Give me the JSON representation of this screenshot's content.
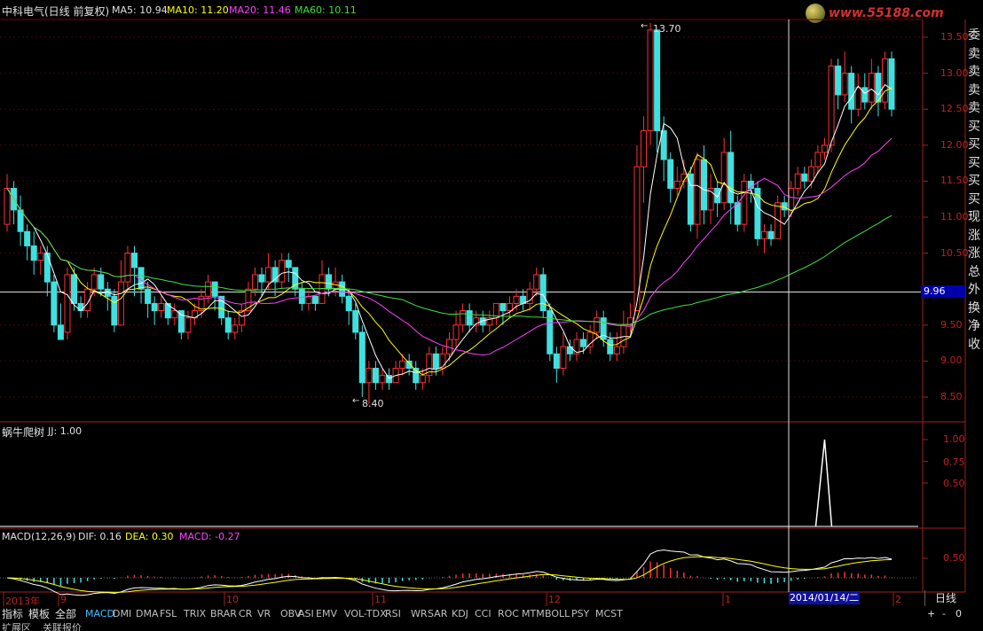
{
  "header": {
    "title": "中科电气(日线 前复权)",
    "ma5": "MA5: 10.94",
    "ma10": "MA10: 11.20",
    "ma20": "MA20: 11.46",
    "ma60": "MA60: 10.11"
  },
  "colors": {
    "ma5": "#ffffff",
    "ma10": "#ffff00",
    "ma20": "#ff40ff",
    "ma60": "#40e040",
    "up": "#ff3030",
    "down": "#40e0e0",
    "axis": "#c02020"
  },
  "logo": "www.55188.com",
  "price_axis": [
    "13.50",
    "13.00",
    "12.50",
    "12.00",
    "11.50",
    "11.00",
    "10.50",
    "9.96",
    "9.50",
    "9.00",
    "8.50"
  ],
  "current_price": "9.96",
  "high_label": "13.70",
  "low_label": "8.40",
  "side_panel": [
    "委",
    "卖",
    "卖",
    "卖",
    "卖",
    "买",
    "买",
    "买",
    "买",
    "买",
    "现",
    "涨",
    "涨",
    "总",
    "外",
    "换",
    "净",
    "收"
  ],
  "indicator1": {
    "title": "蜗牛爬树",
    "value": "JJ: 1.00",
    "axis": [
      "1.00",
      "0.75",
      "0.50"
    ]
  },
  "macd": {
    "title": "MACD(12,26,9)",
    "dif": "DIF: 0.16",
    "dea": "DEA: 0.30",
    "macd": "MACD: -0.27",
    "axis": "0.50"
  },
  "date_axis": [
    "2013年",
    "9",
    "10",
    "11",
    "12",
    "1",
    "2"
  ],
  "cursor_date": "2014/01/14/二",
  "period": "日线",
  "zoom": {
    "plus": "+",
    "minus": "-",
    "value": "0"
  },
  "tabs": [
    "指标",
    "模板",
    "全部",
    "MACD",
    "DMI",
    "DMA",
    "FSL",
    "TRIX",
    "BRAR",
    "CR",
    "VR",
    "OBV",
    "ASI",
    "EMV",
    "VOL-TDX",
    "RSI",
    "WR",
    "SAR",
    "KDJ",
    "CCI",
    "ROC",
    "MTM",
    "BOLL",
    "PSY",
    "MCST"
  ],
  "bottom_bar": [
    "扩展区",
    "关联报价"
  ],
  "chart_data": {
    "type": "candlestick",
    "price_range": [
      8.2,
      13.7
    ],
    "high": 13.7,
    "low": 8.4,
    "current_price_line": 9.96,
    "candles": [
      [
        10.9,
        11.4,
        10.8,
        11.6
      ],
      [
        11.4,
        11.1,
        10.9,
        11.5
      ],
      [
        11.1,
        10.8,
        10.6,
        11.3
      ],
      [
        10.8,
        10.6,
        10.4,
        10.9
      ],
      [
        10.6,
        10.4,
        10.2,
        10.8
      ],
      [
        10.4,
        10.5,
        10.2,
        10.6
      ],
      [
        10.5,
        10.1,
        9.9,
        10.6
      ],
      [
        10.1,
        9.5,
        9.4,
        10.2
      ],
      [
        9.5,
        9.3,
        9.3,
        9.8
      ],
      [
        9.4,
        10.2,
        9.3,
        10.3
      ],
      [
        10.2,
        9.8,
        9.7,
        10.3
      ],
      [
        9.8,
        9.7,
        9.6,
        9.9
      ],
      [
        9.7,
        10.0,
        9.6,
        10.1
      ],
      [
        10.0,
        10.2,
        9.9,
        10.3
      ],
      [
        10.2,
        10.0,
        9.9,
        10.3
      ],
      [
        10.0,
        9.9,
        9.7,
        10.1
      ],
      [
        9.9,
        9.5,
        9.4,
        10.0
      ],
      [
        9.5,
        10.1,
        9.5,
        10.4
      ],
      [
        10.1,
        10.5,
        10.0,
        10.6
      ],
      [
        10.5,
        10.3,
        9.9,
        10.6
      ],
      [
        10.3,
        10.0,
        9.8,
        10.3
      ],
      [
        10.0,
        9.8,
        9.6,
        10.1
      ],
      [
        9.8,
        9.7,
        9.5,
        9.9
      ],
      [
        9.7,
        9.8,
        9.6,
        9.9
      ],
      [
        9.8,
        9.6,
        9.5,
        9.8
      ],
      [
        9.6,
        9.7,
        9.5,
        9.8
      ],
      [
        9.7,
        9.4,
        9.3,
        9.7
      ],
      [
        9.4,
        9.6,
        9.3,
        9.7
      ],
      [
        9.6,
        9.7,
        9.5,
        9.8
      ],
      [
        9.7,
        9.9,
        9.6,
        10.0
      ],
      [
        9.9,
        10.1,
        9.8,
        10.2
      ],
      [
        10.1,
        9.9,
        9.7,
        10.1
      ],
      [
        9.9,
        9.6,
        9.5,
        9.9
      ],
      [
        9.6,
        9.4,
        9.3,
        9.7
      ],
      [
        9.4,
        9.5,
        9.3,
        9.6
      ],
      [
        9.5,
        9.7,
        9.4,
        9.8
      ],
      [
        9.7,
        10.0,
        9.7,
        10.1
      ],
      [
        10.0,
        10.2,
        9.9,
        10.3
      ],
      [
        10.2,
        10.1,
        9.9,
        10.3
      ],
      [
        10.1,
        10.3,
        10.0,
        10.5
      ],
      [
        10.3,
        10.1,
        9.9,
        10.4
      ],
      [
        10.1,
        10.4,
        10.0,
        10.5
      ],
      [
        10.4,
        10.3,
        10.1,
        10.5
      ],
      [
        10.3,
        10.0,
        9.9,
        10.3
      ],
      [
        10.0,
        9.8,
        9.7,
        10.1
      ],
      [
        9.8,
        9.9,
        9.7,
        10.0
      ],
      [
        9.9,
        9.8,
        9.7,
        9.9
      ],
      [
        9.8,
        10.2,
        9.8,
        10.4
      ],
      [
        10.2,
        10.0,
        9.9,
        10.3
      ],
      [
        10.0,
        10.1,
        9.9,
        10.3
      ],
      [
        10.1,
        9.9,
        9.8,
        10.2
      ],
      [
        9.9,
        9.7,
        9.5,
        10.0
      ],
      [
        9.7,
        9.4,
        9.3,
        9.8
      ],
      [
        9.4,
        8.7,
        8.5,
        9.5
      ],
      [
        8.7,
        8.9,
        8.4,
        9.0
      ],
      [
        8.9,
        8.7,
        8.6,
        9.0
      ],
      [
        8.7,
        8.8,
        8.6,
        8.9
      ],
      [
        8.8,
        8.7,
        8.6,
        8.9
      ],
      [
        8.7,
        8.9,
        8.7,
        9.0
      ],
      [
        8.9,
        9.0,
        8.8,
        9.1
      ],
      [
        9.0,
        8.9,
        8.8,
        9.1
      ],
      [
        8.9,
        8.7,
        8.6,
        9.0
      ],
      [
        8.7,
        8.8,
        8.6,
        8.9
      ],
      [
        8.8,
        9.1,
        8.7,
        9.2
      ],
      [
        9.1,
        8.9,
        8.8,
        9.2
      ],
      [
        8.9,
        9.1,
        8.8,
        9.2
      ],
      [
        9.1,
        9.3,
        9.0,
        9.4
      ],
      [
        9.3,
        9.5,
        9.2,
        9.7
      ],
      [
        9.5,
        9.7,
        9.4,
        9.8
      ],
      [
        9.7,
        9.5,
        9.4,
        9.8
      ],
      [
        9.5,
        9.6,
        9.4,
        9.7
      ],
      [
        9.6,
        9.5,
        9.4,
        9.7
      ],
      [
        9.5,
        9.6,
        9.4,
        9.7
      ],
      [
        9.6,
        9.8,
        9.5,
        9.8
      ],
      [
        9.8,
        9.7,
        9.5,
        9.8
      ],
      [
        9.7,
        9.8,
        9.6,
        9.9
      ],
      [
        9.8,
        9.9,
        9.7,
        10.0
      ],
      [
        9.9,
        9.8,
        9.7,
        10.0
      ],
      [
        9.8,
        10.0,
        9.7,
        10.1
      ],
      [
        10.0,
        10.2,
        9.9,
        10.3
      ],
      [
        10.2,
        9.7,
        9.6,
        10.3
      ],
      [
        9.7,
        9.1,
        9.0,
        9.8
      ],
      [
        9.1,
        8.9,
        8.7,
        9.2
      ],
      [
        8.9,
        9.2,
        8.8,
        9.4
      ],
      [
        9.2,
        9.1,
        9.0,
        9.3
      ],
      [
        9.1,
        9.3,
        9.0,
        9.4
      ],
      [
        9.3,
        9.2,
        9.1,
        9.4
      ],
      [
        9.2,
        9.4,
        9.1,
        9.5
      ],
      [
        9.4,
        9.6,
        9.3,
        9.7
      ],
      [
        9.6,
        9.3,
        9.2,
        9.7
      ],
      [
        9.3,
        9.1,
        9.0,
        9.4
      ],
      [
        9.1,
        9.2,
        9.0,
        9.4
      ],
      [
        9.2,
        9.5,
        9.1,
        9.7
      ],
      [
        9.5,
        9.6,
        9.4,
        9.8
      ],
      [
        9.7,
        11.7,
        9.7,
        12.0
      ],
      [
        11.7,
        12.2,
        11.2,
        12.4
      ],
      [
        12.2,
        13.6,
        12.0,
        13.7
      ],
      [
        13.6,
        12.2,
        11.9,
        13.6
      ],
      [
        12.2,
        11.8,
        11.5,
        12.4
      ],
      [
        11.8,
        11.4,
        11.2,
        11.9
      ],
      [
        11.4,
        11.5,
        11.3,
        11.7
      ],
      [
        11.5,
        11.6,
        11.4,
        11.8
      ],
      [
        11.6,
        10.9,
        10.8,
        11.7
      ],
      [
        10.9,
        11.8,
        10.7,
        11.9
      ],
      [
        11.8,
        11.1,
        10.9,
        12.0
      ],
      [
        11.1,
        11.4,
        10.9,
        11.6
      ],
      [
        11.4,
        11.2,
        11.0,
        11.5
      ],
      [
        11.2,
        11.9,
        11.1,
        12.1
      ],
      [
        11.9,
        11.2,
        10.9,
        12.2
      ],
      [
        11.2,
        10.9,
        10.8,
        11.3
      ],
      [
        10.9,
        11.5,
        10.8,
        11.6
      ],
      [
        11.5,
        11.4,
        11.2,
        11.6
      ],
      [
        11.4,
        10.7,
        10.6,
        11.5
      ],
      [
        10.7,
        10.8,
        10.5,
        10.9
      ],
      [
        10.8,
        10.7,
        10.6,
        10.9
      ],
      [
        10.7,
        11.2,
        10.7,
        11.3
      ],
      [
        11.2,
        11.1,
        11.0,
        11.3
      ],
      [
        11.1,
        11.4,
        11.0,
        11.5
      ],
      [
        11.4,
        11.6,
        11.3,
        11.7
      ],
      [
        11.6,
        11.5,
        11.4,
        11.7
      ],
      [
        11.5,
        11.7,
        11.4,
        11.8
      ],
      [
        11.7,
        11.9,
        11.6,
        12.0
      ],
      [
        11.9,
        12.0,
        11.8,
        12.1
      ],
      [
        12.0,
        13.1,
        11.9,
        13.2
      ],
      [
        13.1,
        12.7,
        12.5,
        13.2
      ],
      [
        12.7,
        13.0,
        12.6,
        13.3
      ],
      [
        13.0,
        12.5,
        12.3,
        13.1
      ],
      [
        12.5,
        12.8,
        12.4,
        13.0
      ],
      [
        12.8,
        12.6,
        12.5,
        13.0
      ],
      [
        12.6,
        13.0,
        12.5,
        13.2
      ],
      [
        13.0,
        12.6,
        12.4,
        13.1
      ],
      [
        12.6,
        13.2,
        12.5,
        13.3
      ],
      [
        13.2,
        12.5,
        12.4,
        13.3
      ]
    ],
    "indicator_spike": {
      "series": "JJ",
      "value": 1.0,
      "at_candle": 122
    },
    "macd_axis_label": 0.5
  }
}
